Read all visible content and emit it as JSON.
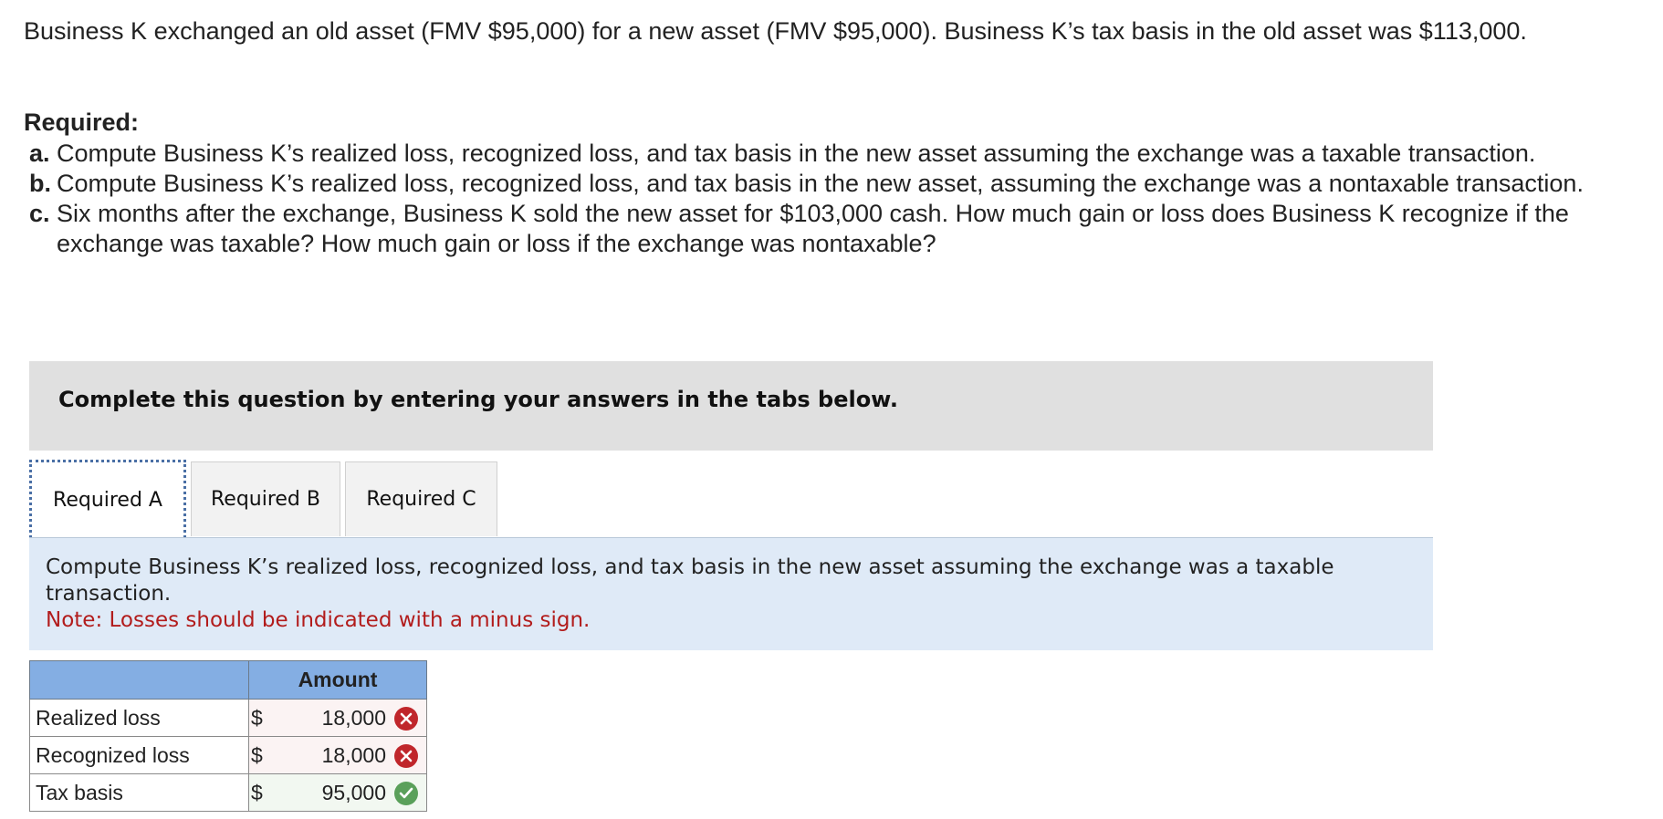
{
  "question": {
    "intro": "Business K exchanged an old asset (FMV $95,000) for a new asset (FMV $95,000). Business K’s tax basis in the old asset was $113,000.",
    "required_heading": "Required:",
    "items": [
      {
        "letter": "a.",
        "text": "Compute Business K’s realized loss, recognized loss, and tax basis in the new asset assuming the exchange was a taxable transaction."
      },
      {
        "letter": "b.",
        "text": "Compute Business K’s realized loss, recognized loss, and tax basis in the new asset, assuming the exchange was a nontaxable transaction."
      },
      {
        "letter": "c.",
        "text": "Six months after the exchange, Business K sold the new asset for $103,000 cash. How much gain or loss does Business K recognize if the exchange was taxable? How much gain or loss if the exchange was nontaxable?"
      }
    ]
  },
  "banner": {
    "text": "Complete this question by entering your answers in the tabs below."
  },
  "tabs": [
    {
      "label": "Required A",
      "active": true
    },
    {
      "label": "Required B",
      "active": false
    },
    {
      "label": "Required C",
      "active": false
    }
  ],
  "instructions": {
    "text": "Compute Business K’s realized loss, recognized loss, and tax basis in the new asset assuming the exchange was a taxable transaction.",
    "note": "Note: Losses should be indicated with a minus sign."
  },
  "answer_table": {
    "header_label": "",
    "header_amount": "Amount",
    "rows": [
      {
        "label": "Realized loss",
        "currency": "$",
        "value": "18,000",
        "status": "incorrect",
        "status_icon": "x-circle-icon"
      },
      {
        "label": "Recognized loss",
        "currency": "$",
        "value": "18,000",
        "status": "incorrect",
        "status_icon": "x-circle-icon"
      },
      {
        "label": "Tax basis",
        "currency": "$",
        "value": "95,000",
        "status": "correct",
        "status_icon": "check-circle-icon"
      }
    ]
  },
  "colors": {
    "banner_bg": "#e0e0e0",
    "instructions_bg": "#dfeaf7",
    "note_red": "#b21c1c",
    "table_header_blue": "#84aee3",
    "incorrect_red": "#c0262b",
    "correct_green": "#5aa05a"
  }
}
